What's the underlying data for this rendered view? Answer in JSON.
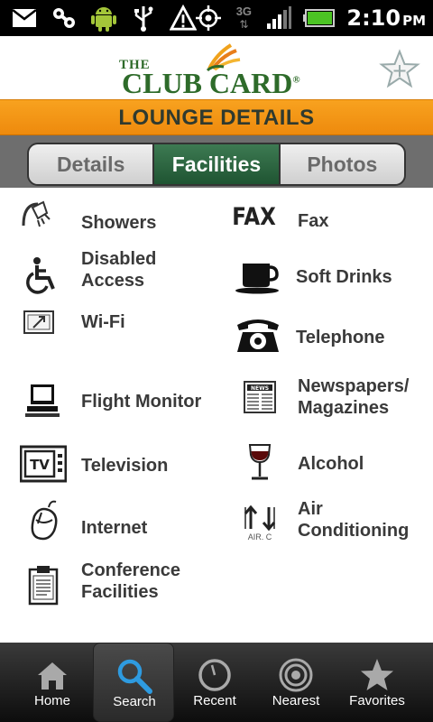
{
  "status_bar": {
    "time": "2:10",
    "ampm": "PM",
    "network": "3G",
    "icons": [
      "mail-icon",
      "voicemail-icon",
      "android-icon",
      "usb-icon",
      "warning-icon",
      "gps-icon",
      "signal-icon",
      "battery-icon"
    ]
  },
  "header": {
    "logo_the": "THE",
    "logo_main": "CLUB CARD",
    "logo_reg": "®",
    "favorite_icon": "star-plus-icon"
  },
  "titlebar": {
    "title": "LOUNGE DETAILS"
  },
  "tabs": [
    {
      "label": "Details",
      "active": false
    },
    {
      "label": "Facilities",
      "active": true
    },
    {
      "label": "Photos",
      "active": false
    }
  ],
  "facilities": {
    "showers": {
      "line1": "Showers",
      "icon": "shower-icon"
    },
    "fax": {
      "line1": "Fax",
      "icon": "fax-icon"
    },
    "disabled": {
      "line1": "Disabled",
      "line2": "Access",
      "icon": "wheelchair-icon"
    },
    "soft_drinks": {
      "line1": "Soft Drinks",
      "icon": "cup-icon"
    },
    "wifi": {
      "line1": "Wi-Fi",
      "icon": "wifi-icon"
    },
    "telephone": {
      "line1": "Telephone",
      "icon": "telephone-icon"
    },
    "flight_monitor": {
      "line1": "Flight Monitor",
      "icon": "computer-icon"
    },
    "newspapers": {
      "line1": "Newspapers/",
      "line2": "Magazines",
      "icon": "newspaper-icon"
    },
    "television": {
      "line1": "Television",
      "icon": "tv-icon"
    },
    "alcohol": {
      "line1": "Alcohol",
      "icon": "wine-glass-icon"
    },
    "internet": {
      "line1": "Internet",
      "icon": "mouse-icon"
    },
    "air_conditioning": {
      "line1": "Air",
      "line2": "Conditioning",
      "icon_text": "AIR. C",
      "icon": "air-conditioning-icon"
    },
    "conference": {
      "line1": "Conference",
      "line2": "Facilities",
      "icon": "clipboard-icon"
    }
  },
  "bottom_nav": [
    {
      "label": "Home",
      "icon": "home-icon",
      "active": false
    },
    {
      "label": "Search",
      "icon": "search-icon",
      "active": true
    },
    {
      "label": "Recent",
      "icon": "clock-icon",
      "active": false
    },
    {
      "label": "Nearest",
      "icon": "target-icon",
      "active": false
    },
    {
      "label": "Favorites",
      "icon": "star-icon",
      "active": false
    }
  ],
  "colors": {
    "orange": "#f39a17",
    "green_brand": "#2e6b2a",
    "active_tab": "#2a6340"
  }
}
